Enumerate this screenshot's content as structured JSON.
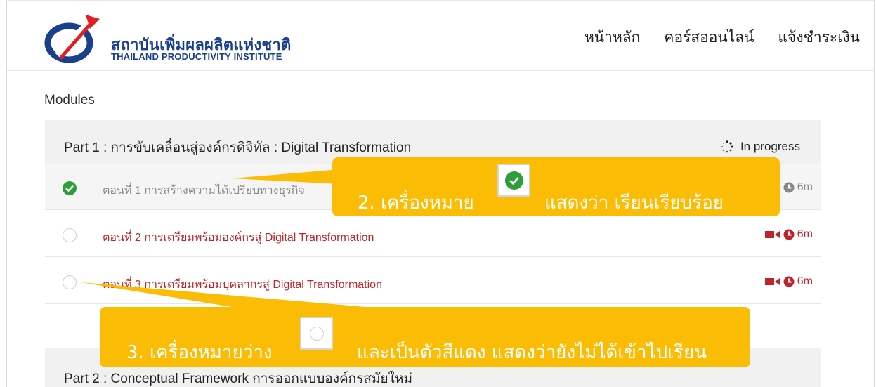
{
  "header": {
    "logo_th": "สถาบันเพิ่มผลผลิตแห่งชาติ",
    "logo_en": "THAILAND PRODUCTIVITY INSTITUTE",
    "nav": [
      "หน้าหลัก",
      "คอร์สออนไลน์",
      "แจ้งชำระเงิน"
    ]
  },
  "modules": {
    "title": "Modules",
    "part1": {
      "title": "Part 1 : การขับเคลื่อนสู่องค์กรดิจิทัล : Digital Transformation",
      "status": "In progress",
      "status_icon": "spinner-icon"
    },
    "lessons": [
      {
        "title": "ตอนที่ 1 การสร้างความได้เปรียบทางธุรกิจ",
        "duration": "6m",
        "completed": true
      },
      {
        "title": "ตอนที่ 2 การเตรียมพร้อมองค์กรสู่ Digital Transformation",
        "duration": "6m",
        "completed": false
      },
      {
        "title": "ตอนที่ 3 การเตรียมพร้อมบุคลากรสู่ Digital Transformation",
        "duration": "6m",
        "completed": false
      }
    ],
    "part2": {
      "title": "Part 2 : Conceptual Framework การออกแบบองค์กรสมัยใหม่"
    }
  },
  "callouts": {
    "c2": {
      "before": "2. เครื่องหมาย",
      "after": "แสดงว่า เรียนเรียบร้อย"
    },
    "c3": {
      "before": "3. เครื่องหมายว่าง",
      "after": "และเป็นตัวสีแดง แสดงว่ายังไม่ได้เข้าไปเรียน"
    }
  },
  "colors": {
    "accent_red": "#c0232a",
    "check_green": "#2e9d3a",
    "callout_yellow": "#fbbc05",
    "brand_blue": "#1b3f8f"
  }
}
